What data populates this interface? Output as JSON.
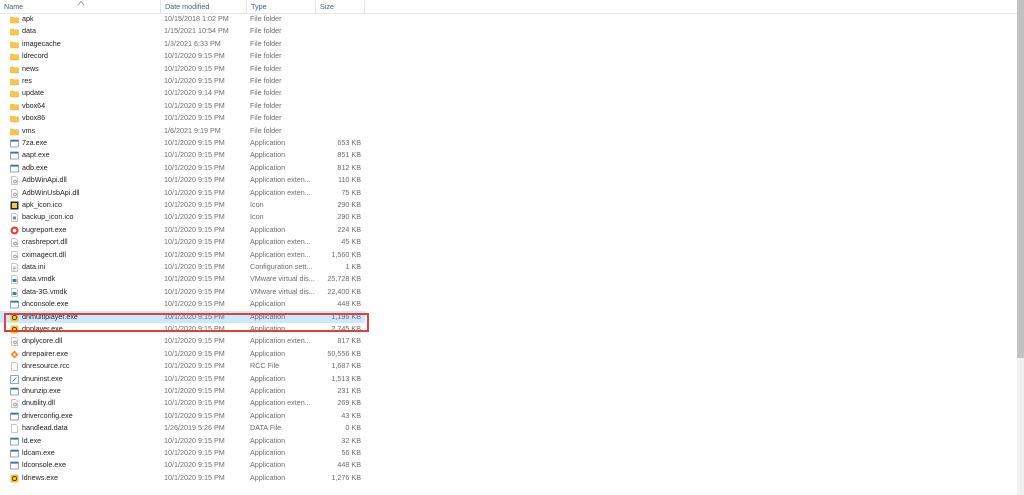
{
  "columns": {
    "name": "Name",
    "date": "Date modified",
    "type": "Type",
    "size": "Size"
  },
  "colors": {
    "folder": "#f5c74e",
    "selected_bg": "#cce8ff",
    "highlight_border": "#e0403a"
  },
  "files": [
    {
      "name": "apk",
      "date": "10/15/2018 1:02 PM",
      "type": "File folder",
      "size": "",
      "icon": "folder-icon"
    },
    {
      "name": "data",
      "date": "1/15/2021 10:54 PM",
      "type": "File folder",
      "size": "",
      "icon": "folder-icon"
    },
    {
      "name": "imagecache",
      "date": "1/3/2021 6:33 PM",
      "type": "File folder",
      "size": "",
      "icon": "folder-icon"
    },
    {
      "name": "ldrecord",
      "date": "10/1/2020 9:15 PM",
      "type": "File folder",
      "size": "",
      "icon": "folder-icon"
    },
    {
      "name": "news",
      "date": "10/1/2020 9:15 PM",
      "type": "File folder",
      "size": "",
      "icon": "folder-icon"
    },
    {
      "name": "res",
      "date": "10/1/2020 9:15 PM",
      "type": "File folder",
      "size": "",
      "icon": "folder-icon"
    },
    {
      "name": "update",
      "date": "10/1/2020 9:14 PM",
      "type": "File folder",
      "size": "",
      "icon": "folder-icon"
    },
    {
      "name": "vbox64",
      "date": "10/1/2020 9:15 PM",
      "type": "File folder",
      "size": "",
      "icon": "folder-icon"
    },
    {
      "name": "vbox86",
      "date": "10/1/2020 9:15 PM",
      "type": "File folder",
      "size": "",
      "icon": "folder-icon"
    },
    {
      "name": "vms",
      "date": "1/6/2021 9:19 PM",
      "type": "File folder",
      "size": "",
      "icon": "folder-icon"
    },
    {
      "name": "7za.exe",
      "date": "10/1/2020 9:15 PM",
      "type": "Application",
      "size": "653 KB",
      "icon": "application-icon"
    },
    {
      "name": "aapt.exe",
      "date": "10/1/2020 9:15 PM",
      "type": "Application",
      "size": "851 KB",
      "icon": "application-icon"
    },
    {
      "name": "adb.exe",
      "date": "10/1/2020 9:15 PM",
      "type": "Application",
      "size": "812 KB",
      "icon": "application-icon"
    },
    {
      "name": "AdbWinApi.dll",
      "date": "10/1/2020 9:15 PM",
      "type": "Application exten...",
      "size": "110 KB",
      "icon": "dll-icon"
    },
    {
      "name": "AdbWinUsbApi.dll",
      "date": "10/1/2020 9:15 PM",
      "type": "Application exten...",
      "size": "75 KB",
      "icon": "dll-icon"
    },
    {
      "name": "apk_icon.ico",
      "date": "10/1/2020 9:15 PM",
      "type": "Icon",
      "size": "290 KB",
      "icon": "ico-icon"
    },
    {
      "name": "backup_icon.ico",
      "date": "10/1/2020 9:15 PM",
      "type": "Icon",
      "size": "290 KB",
      "icon": "ico-file-icon"
    },
    {
      "name": "bugreport.exe",
      "date": "10/1/2020 9:15 PM",
      "type": "Application",
      "size": "224 KB",
      "icon": "bugreport-icon"
    },
    {
      "name": "crashreport.dll",
      "date": "10/1/2020 9:15 PM",
      "type": "Application exten...",
      "size": "45 KB",
      "icon": "dll-icon"
    },
    {
      "name": "cximagecrt.dll",
      "date": "10/1/2020 9:15 PM",
      "type": "Application exten...",
      "size": "1,560 KB",
      "icon": "dll-icon"
    },
    {
      "name": "data.ini",
      "date": "10/1/2020 9:15 PM",
      "type": "Configuration sett...",
      "size": "1 KB",
      "icon": "ini-icon"
    },
    {
      "name": "data.vmdk",
      "date": "10/1/2020 9:15 PM",
      "type": "VMware virtual dis...",
      "size": "25,728 KB",
      "icon": "vmdk-icon"
    },
    {
      "name": "data-3G.vmdk",
      "date": "10/1/2020 9:15 PM",
      "type": "VMware virtual dis...",
      "size": "22,400 KB",
      "icon": "vmdk-icon"
    },
    {
      "name": "dnconsole.exe",
      "date": "10/1/2020 9:15 PM",
      "type": "Application",
      "size": "448 KB",
      "icon": "application-icon"
    },
    {
      "name": "dnmultiplayer.exe",
      "date": "10/1/2020 9:15 PM",
      "type": "Application",
      "size": "1,196 KB",
      "icon": "ldplayer-icon",
      "selected": true
    },
    {
      "name": "dnplayer.exe",
      "date": "10/1/2020 9:15 PM",
      "type": "Application",
      "size": "2,745 KB",
      "icon": "ldplayer-icon"
    },
    {
      "name": "dnplycore.dll",
      "date": "10/1/2020 9:15 PM",
      "type": "Application exten...",
      "size": "817 KB",
      "icon": "dll-icon"
    },
    {
      "name": "dnrepairer.exe",
      "date": "10/1/2020 9:15 PM",
      "type": "Application",
      "size": "50,556 KB",
      "icon": "repairer-icon"
    },
    {
      "name": "dnresource.rcc",
      "date": "10/1/2020 9:15 PM",
      "type": "RCC File",
      "size": "1,687 KB",
      "icon": "blank-file-icon"
    },
    {
      "name": "dnuninst.exe",
      "date": "10/1/2020 9:15 PM",
      "type": "Application",
      "size": "1,513 KB",
      "icon": "uninstall-icon"
    },
    {
      "name": "dnunzip.exe",
      "date": "10/1/2020 9:15 PM",
      "type": "Application",
      "size": "231 KB",
      "icon": "application-icon"
    },
    {
      "name": "dnutility.dll",
      "date": "10/1/2020 9:15 PM",
      "type": "Application exten...",
      "size": "269 KB",
      "icon": "dll-icon"
    },
    {
      "name": "driverconfig.exe",
      "date": "10/1/2020 9:15 PM",
      "type": "Application",
      "size": "43 KB",
      "icon": "application-icon"
    },
    {
      "name": "handlead.data",
      "date": "1/26/2019 5:26 PM",
      "type": "DATA File",
      "size": "0 KB",
      "icon": "blank-file-icon"
    },
    {
      "name": "ld.exe",
      "date": "10/1/2020 9:15 PM",
      "type": "Application",
      "size": "32 KB",
      "icon": "application-icon"
    },
    {
      "name": "ldcam.exe",
      "date": "10/1/2020 9:15 PM",
      "type": "Application",
      "size": "56 KB",
      "icon": "application-icon"
    },
    {
      "name": "ldconsole.exe",
      "date": "10/1/2020 9:15 PM",
      "type": "Application",
      "size": "448 KB",
      "icon": "application-icon"
    },
    {
      "name": "ldnews.exe",
      "date": "10/1/2020 9:15 PM",
      "type": "Application",
      "size": "1,276 KB",
      "icon": "ldplayer-icon"
    }
  ]
}
